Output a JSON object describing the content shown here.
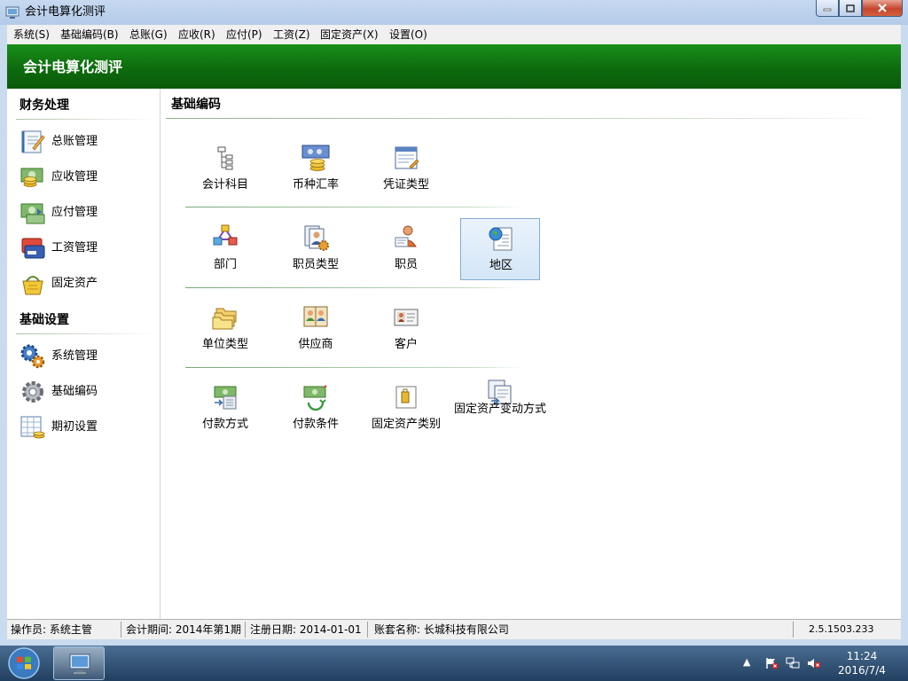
{
  "window": {
    "title": "会计电算化测评"
  },
  "menu": [
    "系统(S)",
    "基础编码(B)",
    "总账(G)",
    "应收(R)",
    "应付(P)",
    "工资(Z)",
    "固定资产(X)",
    "设置(O)"
  ],
  "banner": {
    "title": "会计电算化测评"
  },
  "sidebar": {
    "sections": [
      {
        "title": "财务处理",
        "items": [
          {
            "label": "总账管理",
            "icon": "ledger-icon"
          },
          {
            "label": "应收管理",
            "icon": "receivable-icon"
          },
          {
            "label": "应付管理",
            "icon": "payable-icon"
          },
          {
            "label": "工资管理",
            "icon": "payroll-icon"
          },
          {
            "label": "固定资产",
            "icon": "fixed-asset-icon"
          }
        ]
      },
      {
        "title": "基础设置",
        "items": [
          {
            "label": "系统管理",
            "icon": "gears-icon"
          },
          {
            "label": "基础编码",
            "icon": "gear-icon"
          },
          {
            "label": "期初设置",
            "icon": "spreadsheet-icon"
          }
        ]
      }
    ]
  },
  "main": {
    "title": "基础编码",
    "groups": [
      [
        {
          "label": "会计科目",
          "icon": "tree-icon"
        },
        {
          "label": "币种汇率",
          "icon": "currency-icon"
        },
        {
          "label": "凭证类型",
          "icon": "voucher-icon"
        }
      ],
      [
        {
          "label": "部门",
          "icon": "department-icon"
        },
        {
          "label": "职员类型",
          "icon": "staff-type-icon"
        },
        {
          "label": "职员",
          "icon": "staff-icon"
        },
        {
          "label": "地区",
          "icon": "region-icon",
          "selected": true
        }
      ],
      [
        {
          "label": "单位类型",
          "icon": "folders-icon"
        },
        {
          "label": "供应商",
          "icon": "supplier-icon"
        },
        {
          "label": "客户",
          "icon": "customer-icon"
        }
      ],
      [
        {
          "label": "付款方式",
          "icon": "payment-method-icon"
        },
        {
          "label": "付款条件",
          "icon": "payment-terms-icon"
        },
        {
          "label": "固定资产类别",
          "icon": "asset-category-icon"
        },
        {
          "label": "固定资产变动方式",
          "icon": "asset-change-icon"
        }
      ]
    ]
  },
  "status": {
    "operator": "操作员: 系统主管",
    "period": "会计期间: 2014年第1期",
    "reg_date": "注册日期: 2014-01-01",
    "account": "账套名称: 长城科技有限公司",
    "version": "2.5.1503.233"
  },
  "taskbar": {
    "time": "11:24",
    "date": "2016/7/4"
  },
  "colors": {
    "banner": "#0d6b0d",
    "selection": "#d4e6f7",
    "titlebar": "#c6d9f0"
  }
}
